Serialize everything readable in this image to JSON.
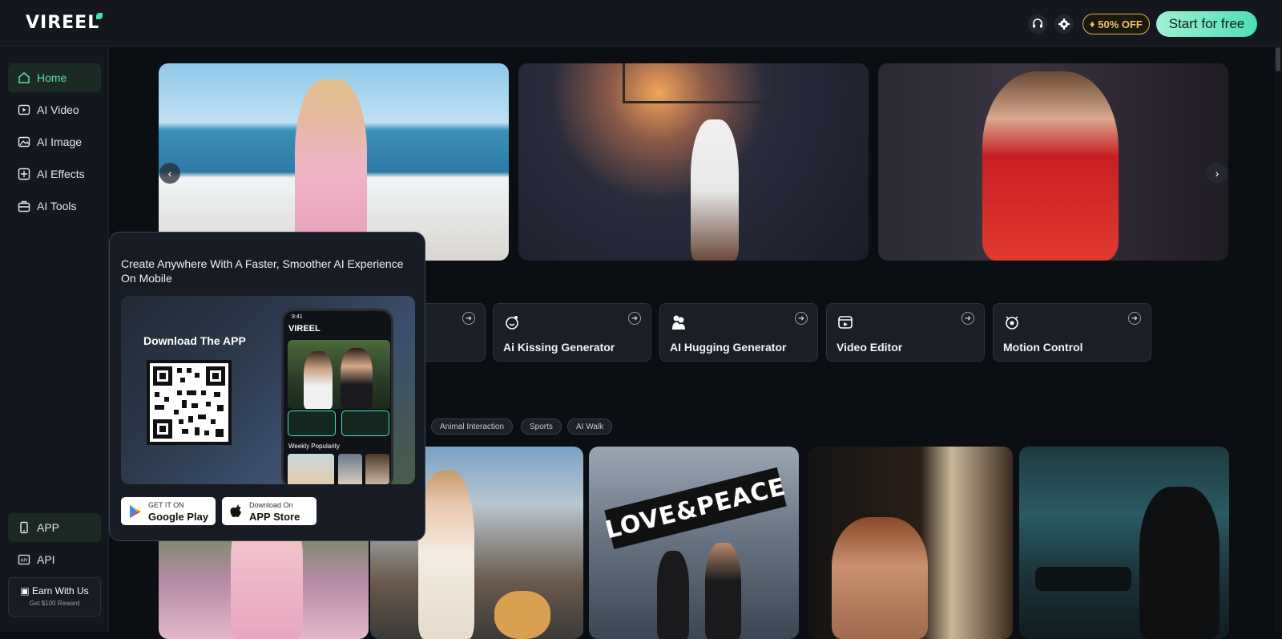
{
  "header": {
    "logo": "VIREEL",
    "discount_badge": "50% OFF",
    "start_button": "Start for free"
  },
  "sidebar": {
    "items": [
      {
        "label": "Home",
        "icon": "home-icon"
      },
      {
        "label": "AI Video",
        "icon": "play-icon"
      },
      {
        "label": "AI Image",
        "icon": "image-icon"
      },
      {
        "label": "AI Effects",
        "icon": "effects-icon"
      },
      {
        "label": "AI Tools",
        "icon": "toolbox-icon"
      }
    ],
    "bottom_items": [
      {
        "label": "APP",
        "icon": "phone-icon"
      },
      {
        "label": "API",
        "icon": "api-icon"
      }
    ],
    "earn": {
      "title": "Earn With Us",
      "subtitle": "Get $100 Reward"
    }
  },
  "popup": {
    "title": "Create Anywhere With A Faster, Smoother AI Experience On Mobile",
    "download_label": "Download The APP",
    "phone": {
      "logo": "VIREEL",
      "weekly": "Weekly Popularity"
    },
    "google_play": {
      "line1": "GET IT ON",
      "line2": "Google Play"
    },
    "app_store": {
      "line1": "Download On",
      "line2": "APP Store"
    }
  },
  "tools": [
    {
      "label": "Ai Kissing Generator",
      "icon": "kiss-icon"
    },
    {
      "label": "AI Hugging Generator",
      "icon": "hug-icon"
    },
    {
      "label": "Video Editor",
      "icon": "video-editor-icon"
    },
    {
      "label": "Motion Control",
      "icon": "motion-icon"
    }
  ],
  "chips": [
    "Animal Interaction",
    "Sports",
    "AI Walk"
  ],
  "gallery": {
    "sign_text": "LOVE&PEACE"
  },
  "colors": {
    "accent": "#4ee0b5",
    "badge": "#f2c463",
    "background": "#0b0e13",
    "panel": "#14181e"
  }
}
